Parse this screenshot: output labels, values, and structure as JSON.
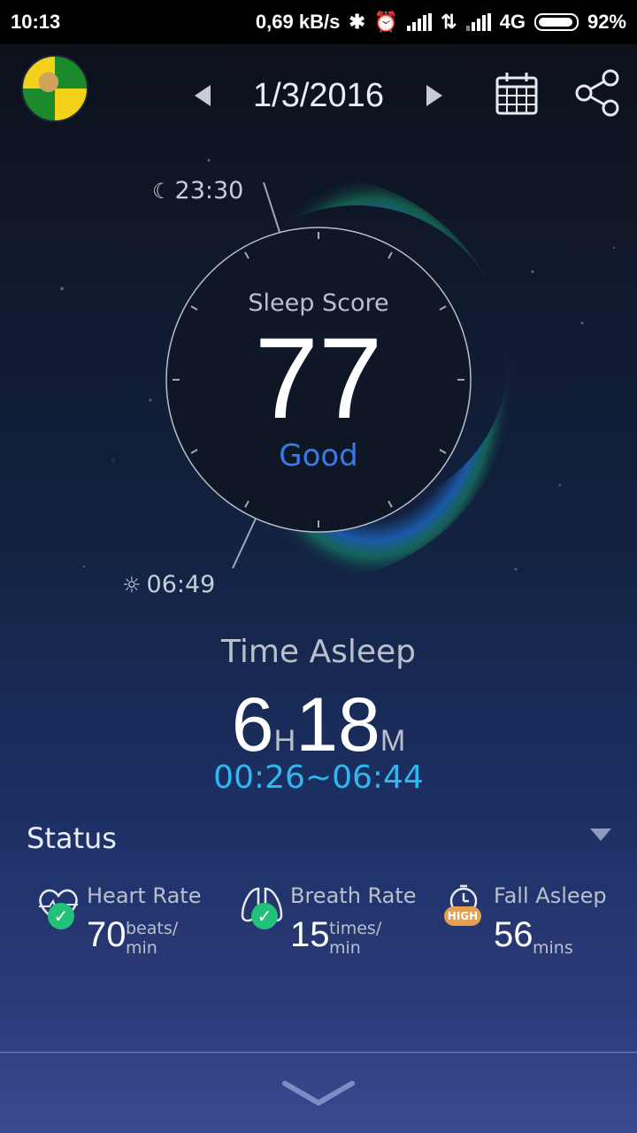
{
  "status_bar": {
    "time": "10:13",
    "speed": "0,69 kB/s",
    "network": "4G",
    "battery": "92%"
  },
  "header": {
    "date": "1/3/2016",
    "avatar": "jamaica-flag-avatar",
    "calendar_icon": "calendar-icon",
    "share_icon": "share-icon"
  },
  "sleep": {
    "score_label": "Sleep Score",
    "score": "77",
    "grade": "Good",
    "bed_time": "23:30",
    "wake_time": "06:49"
  },
  "time_asleep": {
    "title": "Time Asleep",
    "hours": "6",
    "hours_unit": "H",
    "minutes": "18",
    "minutes_unit": "M",
    "range": "00:26~06:44"
  },
  "status": {
    "title": "Status",
    "metrics": [
      {
        "label": "Heart Rate",
        "value": "70",
        "unit_top": "beats/",
        "unit_bottom": "min",
        "icon": "heart-rate-icon",
        "badge": "check"
      },
      {
        "label": "Breath Rate",
        "value": "15",
        "unit_top": "times/",
        "unit_bottom": "min",
        "icon": "lungs-icon",
        "badge": "check"
      },
      {
        "label": "Fall Asleep",
        "value": "56",
        "unit_top": "",
        "unit_bottom": "mins",
        "icon": "timer-icon",
        "badge": "HIGH"
      }
    ]
  },
  "colors": {
    "accent_blue": "#3a7ae8",
    "range_cyan": "#2fb8f0",
    "check_green": "#22c17a",
    "high_orange": "#e59f4d"
  }
}
